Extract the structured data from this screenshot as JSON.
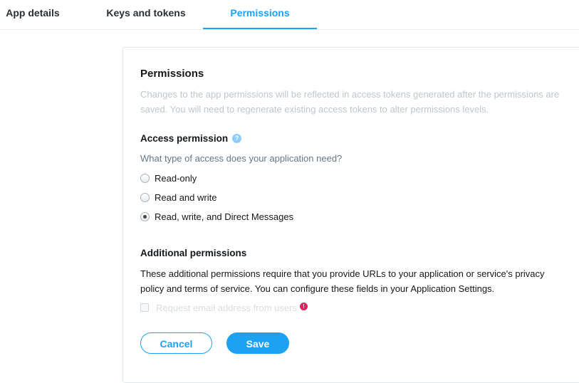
{
  "tabs": [
    {
      "label": "App details",
      "active": false
    },
    {
      "label": "Keys and tokens",
      "active": false
    },
    {
      "label": "Permissions",
      "active": true
    }
  ],
  "permissions": {
    "title": "Permissions",
    "description": "Changes to the app permissions will be reflected in access tokens generated after the permissions are saved. You will need to regenerate existing access tokens to alter permissions levels.",
    "access": {
      "title": "Access permission",
      "help_icon": "question-icon",
      "help_glyph": "?",
      "question": "What type of access does your application need?",
      "options": [
        {
          "label": "Read-only",
          "selected": false
        },
        {
          "label": "Read and write",
          "selected": false
        },
        {
          "label": "Read, write, and Direct Messages",
          "selected": true
        }
      ]
    },
    "additional": {
      "title": "Additional permissions",
      "description": "These additional permissions require that you provide URLs to your application or service's privacy policy and terms of service. You can configure these fields in your Application Settings.",
      "email_checkbox": {
        "label": "Request email address from users",
        "checked": false,
        "disabled": true,
        "alert_icon": "alert-icon",
        "alert_glyph": "!"
      }
    },
    "buttons": {
      "cancel_label": "Cancel",
      "save_label": "Save"
    }
  },
  "colors": {
    "accent": "#1da1f2",
    "alert": "#e0245e",
    "muted_text": "#bfc6cc"
  }
}
